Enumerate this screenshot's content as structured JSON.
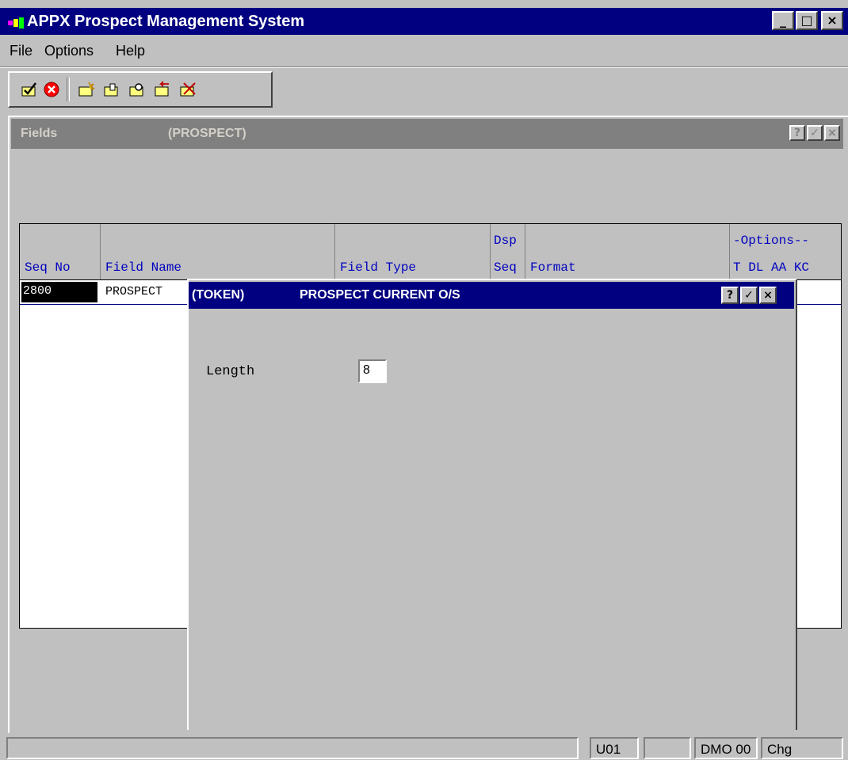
{
  "window": {
    "title": "APPX Prospect Management System",
    "min": "_",
    "max": "□",
    "close": "×"
  },
  "menu": [
    "File",
    "Options",
    "Help"
  ],
  "toolbar": [
    "ok-icon",
    "cancel-icon",
    "new-folder-icon",
    "edit-folder-icon",
    "search-folder-icon",
    "back-folder-icon",
    "delete-folder-icon"
  ],
  "fields_panel": {
    "title": "Fields",
    "subtitle": "(PROSPECT)",
    "buttons": [
      "?",
      "✓",
      "×"
    ]
  },
  "grid": {
    "headers": {
      "seq_no": "Seq No",
      "field_name": "Field Name",
      "field_type": "Field Type",
      "dsp": "Dsp",
      "seq": "Seq",
      "format": "Format",
      "options_top": "-Options--",
      "options": "T DL AA KC"
    },
    "row": {
      "seq_no": "2800",
      "field_name": "PROSPECT"
    }
  },
  "dialog": {
    "title_left": "(TOKEN)",
    "title_right": "PROSPECT CURRENT O/S",
    "buttons": [
      "?",
      "✓",
      "×"
    ],
    "length_label": "Length",
    "length_value": "8"
  },
  "status": {
    "s1": "",
    "s2": "U01",
    "s3": "",
    "s4": "DMO 00",
    "s5": "Chg"
  },
  "colors": {
    "titlebar": "#000080",
    "face": "#c0c0c0",
    "header_text": "#0000c0"
  }
}
